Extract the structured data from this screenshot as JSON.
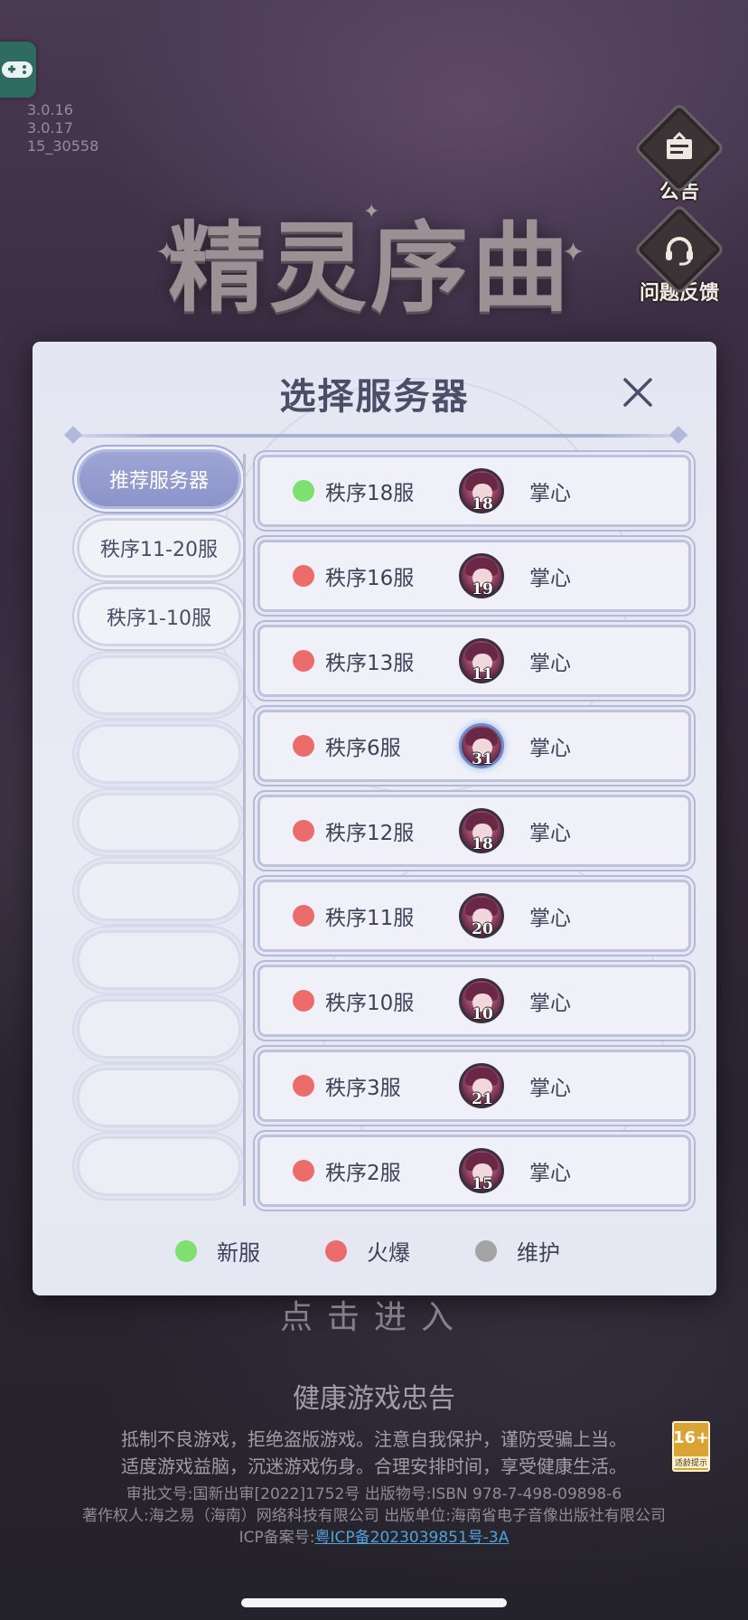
{
  "version_info": [
    "3.0.16",
    "3.0.17",
    "15_30558"
  ],
  "side_buttons": {
    "notice_label": "公告",
    "feedback_label": "问题反馈"
  },
  "game_title": "精灵序曲",
  "modal": {
    "title": "选择服务器",
    "categories": [
      {
        "label": "推荐服务器",
        "active": true
      },
      {
        "label": "秩序11-20服",
        "active": false
      },
      {
        "label": "秩序1-10服",
        "active": false
      }
    ],
    "servers": [
      {
        "name": "秩序18服",
        "status": "new",
        "player_name": "掌心",
        "level": "18"
      },
      {
        "name": "秩序16服",
        "status": "hot",
        "player_name": "掌心",
        "level": "19"
      },
      {
        "name": "秩序13服",
        "status": "hot",
        "player_name": "掌心",
        "level": "11"
      },
      {
        "name": "秩序6服",
        "status": "hot",
        "player_name": "掌心",
        "level": "31"
      },
      {
        "name": "秩序12服",
        "status": "hot",
        "player_name": "掌心",
        "level": "18"
      },
      {
        "name": "秩序11服",
        "status": "hot",
        "player_name": "掌心",
        "level": "20"
      },
      {
        "name": "秩序10服",
        "status": "hot",
        "player_name": "掌心",
        "level": "10"
      },
      {
        "name": "秩序3服",
        "status": "hot",
        "player_name": "掌心",
        "level": "21"
      },
      {
        "name": "秩序2服",
        "status": "hot",
        "player_name": "掌心",
        "level": "15"
      }
    ],
    "legend": [
      {
        "label": "新服",
        "color": "#7ee06f"
      },
      {
        "label": "火爆",
        "color": "#ec6b6b"
      },
      {
        "label": "维护",
        "color": "#a4a4a4"
      }
    ]
  },
  "status_colors": {
    "new": "#7ee06f",
    "hot": "#ec6b6b",
    "maintenance": "#a4a4a4"
  },
  "enter_text": "点击进入",
  "health": {
    "title": "健康游戏忠告",
    "line1": "抵制不良游戏，拒绝盗版游戏。注意自我保护，谨防受骗上当。",
    "line2": "适度游戏益脑，沉迷游戏伤身。合理安排时间，享受健康生活。"
  },
  "legal": {
    "approval": "审批文号:国新出审[2022]1752号 出版物号:ISBN 978-7-498-09898-6",
    "copyright": "著作权人:海之易（海南）网络科技有限公司 出版单位:海南省电子音像出版社有限公司",
    "icp_label": "ICP备案号:",
    "icp_link": "粤ICP备2023039851号-3A"
  },
  "age_badge": {
    "rating": "16+",
    "caption": "适龄提示"
  }
}
